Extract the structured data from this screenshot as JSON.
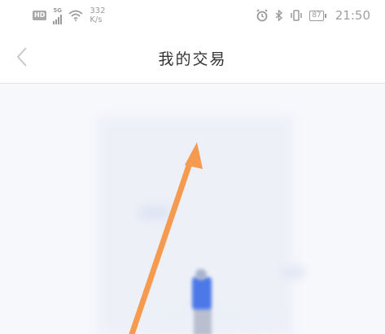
{
  "status_bar": {
    "hd_label": "HD",
    "network_gen": "5G",
    "speed_value": "332",
    "speed_unit": "K/s",
    "battery": "87",
    "time": "21:50"
  },
  "header": {
    "title": "我的交易"
  },
  "colors": {
    "arrow": "#f59a4f",
    "figure": "#4b79e8"
  }
}
